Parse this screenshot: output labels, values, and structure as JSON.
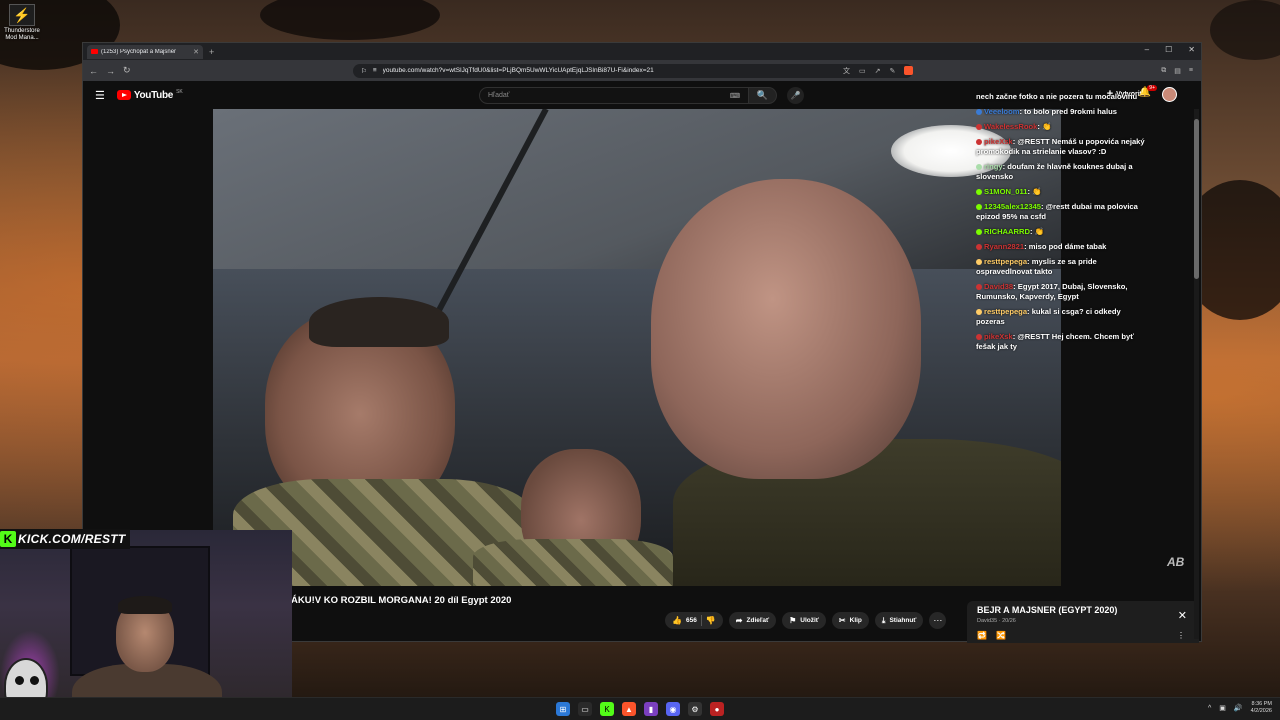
{
  "desktop": {
    "icon_label": "Thunderstore Mod Mana..."
  },
  "browser": {
    "tab_title": "(1253) Psychopat a Majsner",
    "url": "youtube.com/watch?v=wtSlJqTfdU0&list=PLjBQm5UwWLYicUAptEjqLJSlnBi87U-Fi&index=21"
  },
  "youtube": {
    "logo_text": "YouTube",
    "country_code": "SK",
    "search_placeholder": "Hľadať",
    "create_label": "Vytvoriť",
    "notifications_count": "9+"
  },
  "chat": [
    {
      "user": "",
      "text": "nech začne fotko a nie pozera tu mocalovinu",
      "user_color": "#ffffff"
    },
    {
      "user": "Veeeloom",
      "text": "to bolo pred 9rokmi halus",
      "user_color": "#3a7bd5"
    },
    {
      "user": "WakelessRook",
      "text": "👏",
      "user_color": "#cc3333"
    },
    {
      "user": "pikeXsk",
      "text": "@RESTT Nemáš u popovića nejaký promokodik na strielanie vlasov? :D",
      "user_color": "#cc3333"
    },
    {
      "user": "ringy",
      "text": "doufam že hlavně kouknes dubaj a slovensko",
      "user_color": "#aaddaa"
    },
    {
      "user": "S1MON_011",
      "text": "👏",
      "user_color": "#7cfc00"
    },
    {
      "user": "12345alex12345",
      "text": "@restt dubai ma polovica epizod 95% na csfd",
      "user_color": "#7cfc00"
    },
    {
      "user": "RICHAARRD",
      "text": "👏",
      "user_color": "#7cfc00"
    },
    {
      "user": "Ryann2821",
      "text": "miso pod dáme tabak",
      "user_color": "#cc3333"
    },
    {
      "user": "resttpepega",
      "text": "myslis ze sa pride ospravedlnovat takto",
      "user_color": "#ffcc66"
    },
    {
      "user": "David38",
      "text": "Egypt 2017, Dubaj, Slovensko, Rumunsko, Kapverdy, Egypt",
      "user_color": "#cc3333"
    },
    {
      "user": "resttpepega",
      "text": "kukal si csga? ci odkedy pozeras",
      "user_color": "#ffcc66"
    },
    {
      "user": "pikeXsk",
      "text": "@RESTT Hej chcem. Chcem byť fešak jak ty",
      "user_color": "#cc3333"
    }
  ],
  "video": {
    "title": "ÁKU!V KO ROZBIL MORGANA! 20 díl Egypt 2020",
    "likes": "656",
    "share_label": "Zdieľať",
    "save_label": "Uložiť",
    "clip_label": "Klip",
    "download_label": "Stiahnuť"
  },
  "playlist": {
    "title": "BEJR A MAJSNER (EGYPT 2020)",
    "subtitle": "David35 · 20/26"
  },
  "overlay": {
    "kick_text": "KICK.COM/RESTT"
  },
  "taskbar": {
    "time": "8:36 PM",
    "date": "4/2/2026"
  },
  "colors": {
    "youtube_red": "#ff0000",
    "kick_green": "#53fc18"
  }
}
